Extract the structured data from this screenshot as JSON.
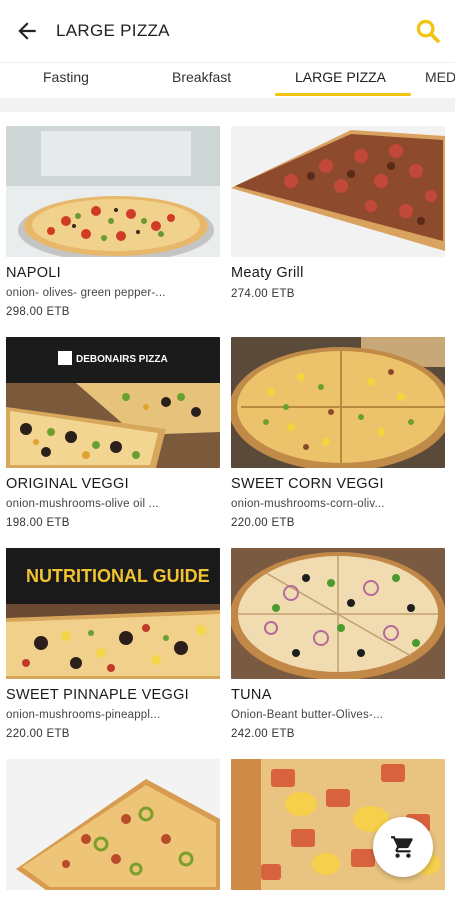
{
  "header": {
    "title": "LARGE PIZZA",
    "back_icon": "arrow-left-icon",
    "search_icon": "search-icon",
    "accent_color": "#f1c40f"
  },
  "tabs": [
    {
      "label": "Fasting"
    },
    {
      "label": "Breakfast"
    },
    {
      "label": "LARGE PIZZA",
      "active": true
    },
    {
      "label": "MED"
    }
  ],
  "products": [
    {
      "name": "NAPOLI",
      "description": "onion- olives- green pepper-...",
      "price": "298.00 ETB"
    },
    {
      "name": "Meaty Grill",
      "description": "",
      "price": "274.00 ETB"
    },
    {
      "name": "ORIGINAL VEGGI",
      "description": "onion-mushrooms-olive oil ...",
      "price": "198.00 ETB",
      "image_text": "DEBONAIRS PIZZA"
    },
    {
      "name": "SWEET CORN VEGGI",
      "description": "onion-mushrooms-corn-oliv...",
      "price": "220.00 ETB"
    },
    {
      "name": "SWEET PINNAPLE VEGGI",
      "description": "onion-mushrooms-pineappl...",
      "price": "220.00 ETB",
      "image_text": "NUTRITIONAL GUIDE"
    },
    {
      "name": "TUNA",
      "description": "Onion-Beant butter-Olives-...",
      "price": "242.00 ETB"
    },
    {
      "name": "",
      "description": "",
      "price": ""
    },
    {
      "name": "",
      "description": "",
      "price": ""
    }
  ],
  "cart_button": {
    "icon": "cart-icon"
  }
}
